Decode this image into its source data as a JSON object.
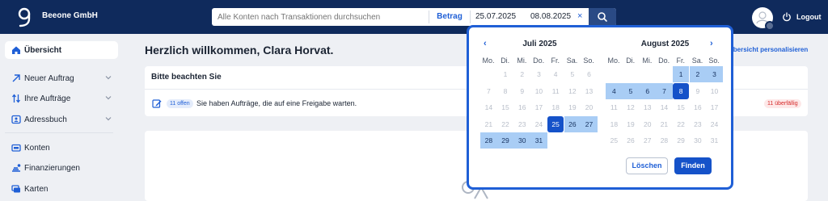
{
  "header": {
    "company": "Beeone GmbH",
    "search_placeholder": "Alle Konten nach Transaktionen durchsuchen",
    "betrag_label": "Betrag",
    "date_from": "25.07.2025",
    "date_to": "08.08.2025",
    "clear_symbol": "×",
    "logout_label": "Logout",
    "colors": {
      "bar": "#0f2a5c",
      "accent": "#1f5fd6"
    }
  },
  "sidebar": {
    "items": [
      {
        "label": "Übersicht",
        "icon": "home-icon",
        "active": true
      },
      {
        "label": "Neuer Auftrag",
        "icon": "arrow-upright-icon",
        "expandable": true
      },
      {
        "label": "Ihre Aufträge",
        "icon": "transfer-arrows-icon",
        "expandable": true
      },
      {
        "label": "Adressbuch",
        "icon": "contact-card-icon",
        "expandable": true
      },
      {
        "label": "Konten",
        "icon": "wallet-icon"
      },
      {
        "label": "Finanzierungen",
        "icon": "coins-icon"
      },
      {
        "label": "Karten",
        "icon": "cards-icon"
      }
    ]
  },
  "main": {
    "welcome": "Herzlich willkommen, Clara Horvat.",
    "customize_link": "Übersicht personalisieren",
    "notice": {
      "title": "Bitte beachten Sie",
      "badge_open": "11 offen",
      "text": "Sie haben Aufträge, die auf eine Freigabe warten.",
      "badge_overdue": "11 überfällig"
    }
  },
  "datepicker": {
    "weekdays": [
      "Mo.",
      "Di.",
      "Mi.",
      "Do.",
      "Fr.",
      "Sa.",
      "So."
    ],
    "prev_symbol": "‹",
    "next_symbol": "›",
    "months": [
      {
        "title": "Juli 2025",
        "days": [
          {
            "d": "1",
            "col": 1,
            "row": 0
          },
          {
            "d": "2",
            "col": 2,
            "row": 0
          },
          {
            "d": "3",
            "col": 3,
            "row": 0
          },
          {
            "d": "4",
            "col": 4,
            "row": 0
          },
          {
            "d": "5",
            "col": 5,
            "row": 0
          },
          {
            "d": "6",
            "col": 6,
            "row": 0
          },
          {
            "d": "7",
            "col": 0,
            "row": 1
          },
          {
            "d": "8",
            "col": 1,
            "row": 1
          },
          {
            "d": "9",
            "col": 2,
            "row": 1
          },
          {
            "d": "10",
            "col": 3,
            "row": 1
          },
          {
            "d": "11",
            "col": 4,
            "row": 1
          },
          {
            "d": "12",
            "col": 5,
            "row": 1
          },
          {
            "d": "13",
            "col": 6,
            "row": 1
          },
          {
            "d": "14",
            "col": 0,
            "row": 2
          },
          {
            "d": "15",
            "col": 1,
            "row": 2
          },
          {
            "d": "16",
            "col": 2,
            "row": 2
          },
          {
            "d": "17",
            "col": 3,
            "row": 2
          },
          {
            "d": "18",
            "col": 4,
            "row": 2
          },
          {
            "d": "19",
            "col": 5,
            "row": 2
          },
          {
            "d": "20",
            "col": 6,
            "row": 2
          },
          {
            "d": "21",
            "col": 0,
            "row": 3
          },
          {
            "d": "22",
            "col": 1,
            "row": 3
          },
          {
            "d": "23",
            "col": 2,
            "row": 3
          },
          {
            "d": "24",
            "col": 3,
            "row": 3
          },
          {
            "d": "25",
            "col": 4,
            "row": 3,
            "state": "sel"
          },
          {
            "d": "26",
            "col": 5,
            "row": 3,
            "state": "range"
          },
          {
            "d": "27",
            "col": 6,
            "row": 3,
            "state": "range"
          },
          {
            "d": "28",
            "col": 0,
            "row": 4,
            "state": "range"
          },
          {
            "d": "29",
            "col": 1,
            "row": 4,
            "state": "range"
          },
          {
            "d": "30",
            "col": 2,
            "row": 4,
            "state": "range"
          },
          {
            "d": "31",
            "col": 3,
            "row": 4,
            "state": "range"
          }
        ]
      },
      {
        "title": "August 2025",
        "days": [
          {
            "d": "1",
            "col": 4,
            "row": 0,
            "state": "range"
          },
          {
            "d": "2",
            "col": 5,
            "row": 0,
            "state": "range"
          },
          {
            "d": "3",
            "col": 6,
            "row": 0,
            "state": "range"
          },
          {
            "d": "4",
            "col": 0,
            "row": 1,
            "state": "range"
          },
          {
            "d": "5",
            "col": 1,
            "row": 1,
            "state": "range"
          },
          {
            "d": "6",
            "col": 2,
            "row": 1,
            "state": "range"
          },
          {
            "d": "7",
            "col": 3,
            "row": 1,
            "state": "range"
          },
          {
            "d": "8",
            "col": 4,
            "row": 1,
            "state": "sel"
          },
          {
            "d": "9",
            "col": 5,
            "row": 1
          },
          {
            "d": "10",
            "col": 6,
            "row": 1
          },
          {
            "d": "11",
            "col": 0,
            "row": 2
          },
          {
            "d": "12",
            "col": 1,
            "row": 2
          },
          {
            "d": "13",
            "col": 2,
            "row": 2
          },
          {
            "d": "14",
            "col": 3,
            "row": 2
          },
          {
            "d": "15",
            "col": 4,
            "row": 2
          },
          {
            "d": "16",
            "col": 5,
            "row": 2
          },
          {
            "d": "17",
            "col": 6,
            "row": 2
          },
          {
            "d": "18",
            "col": 0,
            "row": 3
          },
          {
            "d": "19",
            "col": 1,
            "row": 3
          },
          {
            "d": "20",
            "col": 2,
            "row": 3
          },
          {
            "d": "21",
            "col": 3,
            "row": 3
          },
          {
            "d": "22",
            "col": 4,
            "row": 3
          },
          {
            "d": "23",
            "col": 5,
            "row": 3
          },
          {
            "d": "24",
            "col": 6,
            "row": 3
          },
          {
            "d": "25",
            "col": 0,
            "row": 4
          },
          {
            "d": "26",
            "col": 1,
            "row": 4
          },
          {
            "d": "27",
            "col": 2,
            "row": 4
          },
          {
            "d": "28",
            "col": 3,
            "row": 4
          },
          {
            "d": "29",
            "col": 4,
            "row": 4
          },
          {
            "d": "30",
            "col": 5,
            "row": 4
          },
          {
            "d": "31",
            "col": 6,
            "row": 4
          }
        ]
      }
    ],
    "clear_label": "Löschen",
    "find_label": "Finden"
  }
}
